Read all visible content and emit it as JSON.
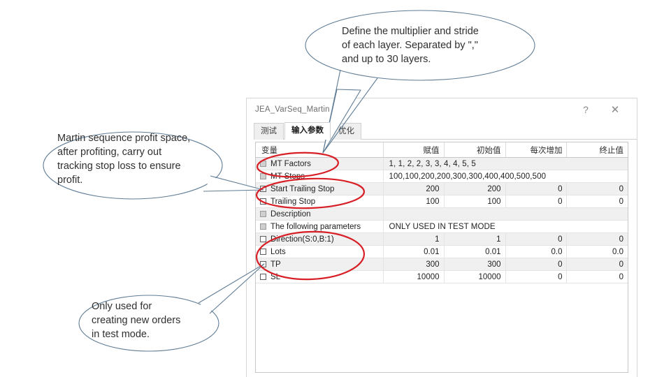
{
  "window": {
    "title": "JEA_VarSeq_Martin",
    "help_label": "?",
    "close_label": "✕"
  },
  "tabs": [
    {
      "label": "测试",
      "selected": false
    },
    {
      "label": "输入参数",
      "selected": true
    },
    {
      "label": "优化",
      "selected": false
    }
  ],
  "table": {
    "headers": {
      "variable": "变量",
      "value": "赋值",
      "initial": "初始值",
      "step": "每次增加",
      "stop": "终止值"
    },
    "rows": [
      {
        "name": "MT Factors",
        "checkbox": "dim",
        "span": true,
        "span_text": "1,   1,   2,   2,   3,   3,   4,   4,   5,   5",
        "value": "",
        "initial": "",
        "step": "",
        "stop": "",
        "shaded": true
      },
      {
        "name": "MT Steps",
        "checkbox": "dim",
        "span": true,
        "span_text": "100,100,200,200,300,300,400,400,500,500",
        "value": "",
        "initial": "",
        "step": "",
        "stop": "",
        "shaded": false
      },
      {
        "name": "Start Trailing Stop",
        "checkbox": "empty",
        "span": false,
        "value": "200",
        "initial": "200",
        "step": "0",
        "stop": "0",
        "shaded": true
      },
      {
        "name": "Trailing Stop",
        "checkbox": "empty",
        "span": false,
        "value": "100",
        "initial": "100",
        "step": "0",
        "stop": "0",
        "shaded": false
      },
      {
        "name": "Description",
        "checkbox": "dim",
        "span": true,
        "span_text": "",
        "value": "",
        "initial": "",
        "step": "",
        "stop": "",
        "shaded": true
      },
      {
        "name": "The following parameters",
        "checkbox": "dim",
        "span": true,
        "span_text": "ONLY USED IN TEST MODE",
        "value": "",
        "initial": "",
        "step": "",
        "stop": "",
        "shaded": false
      },
      {
        "name": "Direction(S:0,B:1)",
        "checkbox": "empty",
        "span": false,
        "value": "1",
        "initial": "1",
        "step": "0",
        "stop": "0",
        "shaded": true
      },
      {
        "name": "Lots",
        "checkbox": "empty",
        "span": false,
        "value": "0.01",
        "initial": "0.01",
        "step": "0.0",
        "stop": "0.0",
        "shaded": false
      },
      {
        "name": "TP",
        "checkbox": "empty",
        "span": false,
        "value": "300",
        "initial": "300",
        "step": "0",
        "stop": "0",
        "shaded": true
      },
      {
        "name": "SL",
        "checkbox": "empty",
        "span": false,
        "value": "10000",
        "initial": "10000",
        "step": "0",
        "stop": "0",
        "shaded": false
      }
    ]
  },
  "annotations": {
    "callout_top": "Define the multiplier and stride\nof each layer. Separated by \",\"\nand up to 30 layers.",
    "callout_left": "Martin sequence profit space,\nafter profiting, carry out\ntracking stop loss to ensure\nprofit.",
    "callout_bottom": "Only used for\ncreating new orders\nin test mode.",
    "bubble_stroke": "#5f7c95",
    "highlight_stroke": "#d81f26"
  }
}
